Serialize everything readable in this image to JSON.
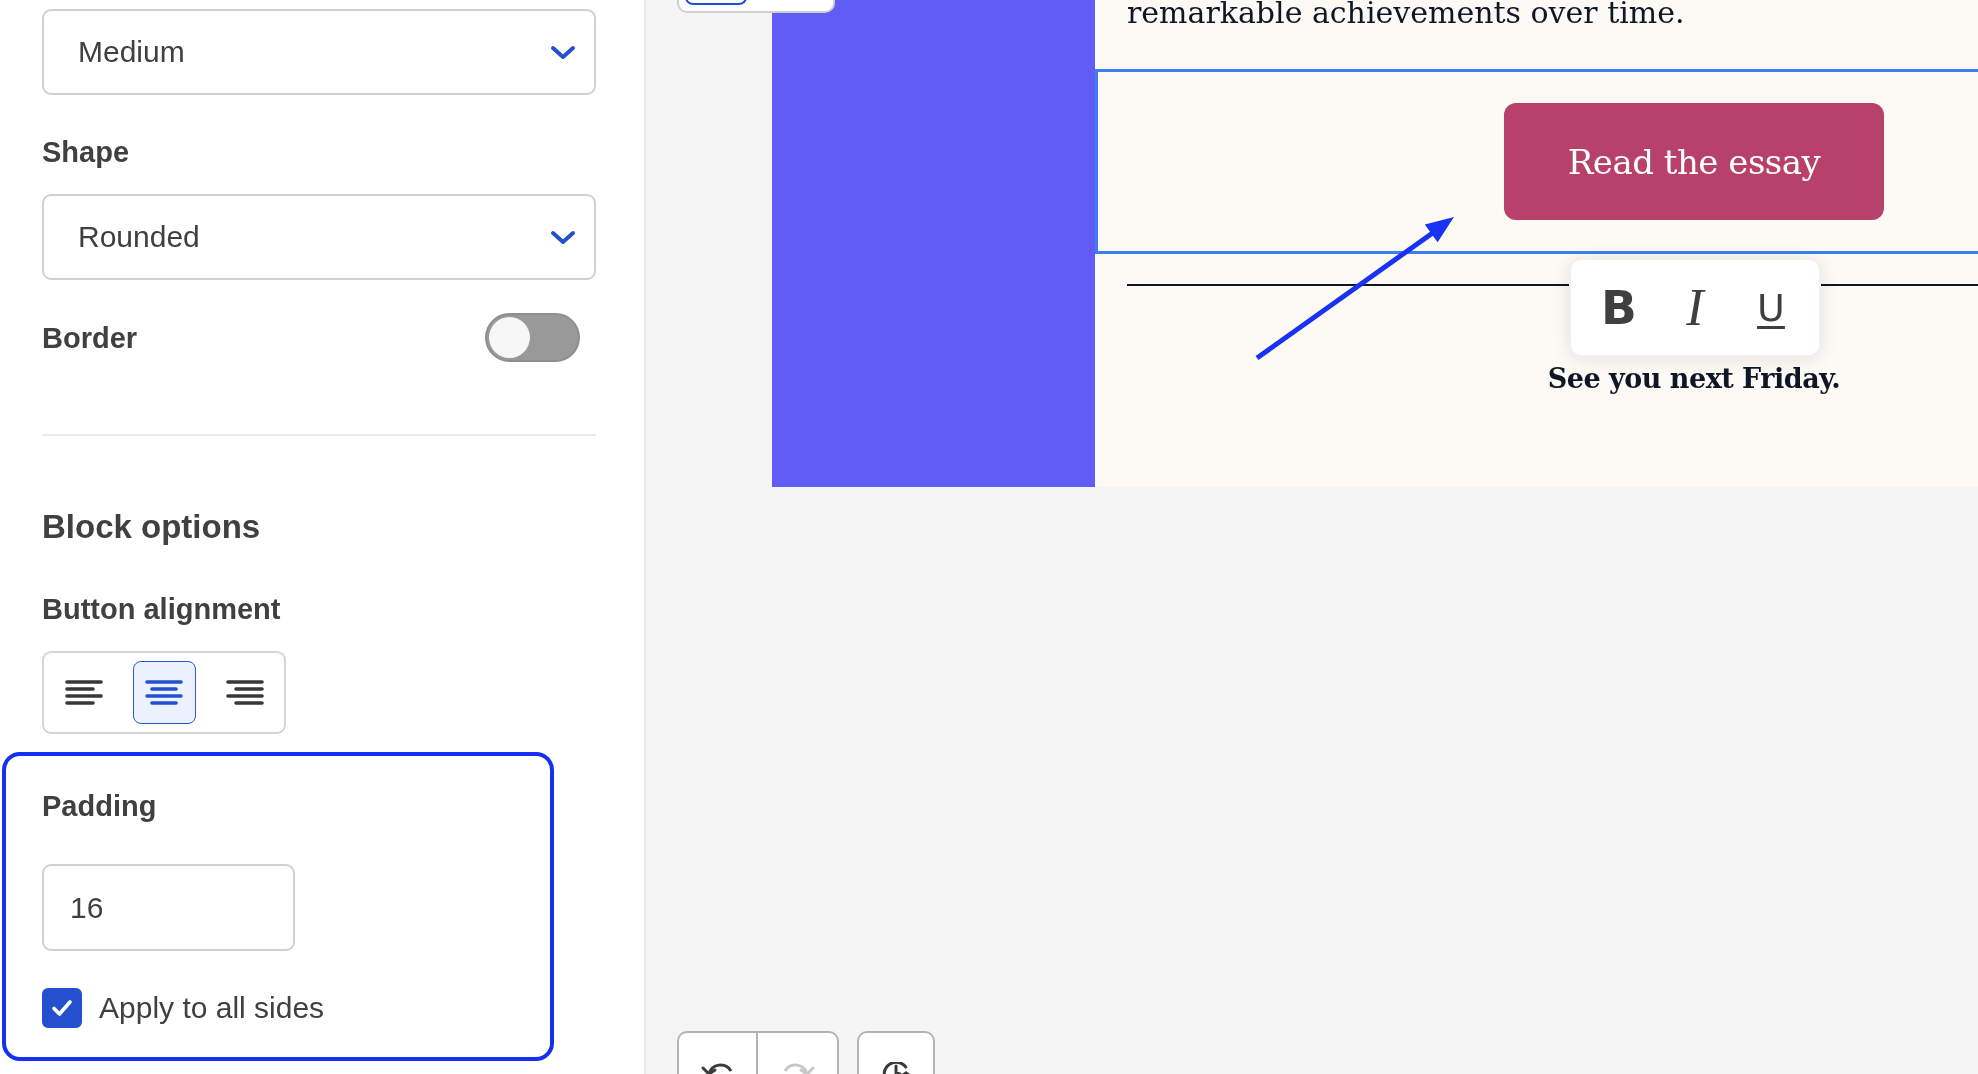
{
  "settings_panel": {
    "size_select": {
      "value": "Medium"
    },
    "shape": {
      "label": "Shape",
      "value": "Rounded"
    },
    "border": {
      "label": "Border",
      "on": false
    },
    "block_options": {
      "title": "Block options",
      "button_alignment": {
        "label": "Button alignment",
        "options": [
          {
            "kind": "left",
            "selected": false
          },
          {
            "kind": "center",
            "selected": true
          },
          {
            "kind": "right",
            "selected": false
          }
        ]
      },
      "padding": {
        "highlighted": true,
        "label": "Padding",
        "value": "16",
        "apply_to_all_sides": {
          "label": "Apply to all sides",
          "checked": true
        }
      }
    }
  },
  "canvas": {
    "view_switch": [
      {
        "selected": true
      },
      {
        "selected": false
      }
    ],
    "email": {
      "paragraph": "remarkable achievements over time.",
      "button_block": {
        "selected": true,
        "button": {
          "label": "Read the essay"
        }
      },
      "format_toolbar": [
        {
          "kind": "bold",
          "label": "B"
        },
        {
          "kind": "italic",
          "label": "I"
        },
        {
          "kind": "underline",
          "label": "U"
        }
      ],
      "closing": "See you next Friday."
    },
    "history_controls": {
      "undo": {
        "disabled": false
      },
      "redo": {
        "disabled": true
      }
    }
  }
}
